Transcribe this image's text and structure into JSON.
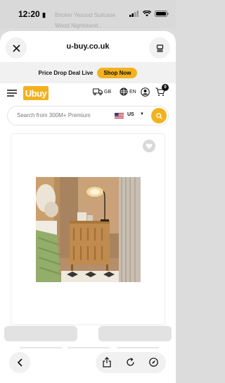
{
  "status_bar": {
    "time": "12:20",
    "background_title_line1": "Bricker Yesood Suitcase",
    "background_title_line2": "Wood Nightstand..."
  },
  "browser": {
    "domain": "u-buy.co.uk",
    "close_icon": "close-icon",
    "tabs_icon": "tabs-icon"
  },
  "promo": {
    "text": "Price Drop Deal Live",
    "button": "Shop Now"
  },
  "header": {
    "logo_text": "Ubuy",
    "region_label": "GB",
    "language_label": "EN",
    "cart_count": "0",
    "accent_color": "#f2b21f"
  },
  "search": {
    "placeholder": "Search from 300M+ Premium",
    "country": "US"
  },
  "toolbar": {
    "icons": [
      "back-icon",
      "share-icon",
      "reload-icon",
      "compass-icon"
    ]
  }
}
